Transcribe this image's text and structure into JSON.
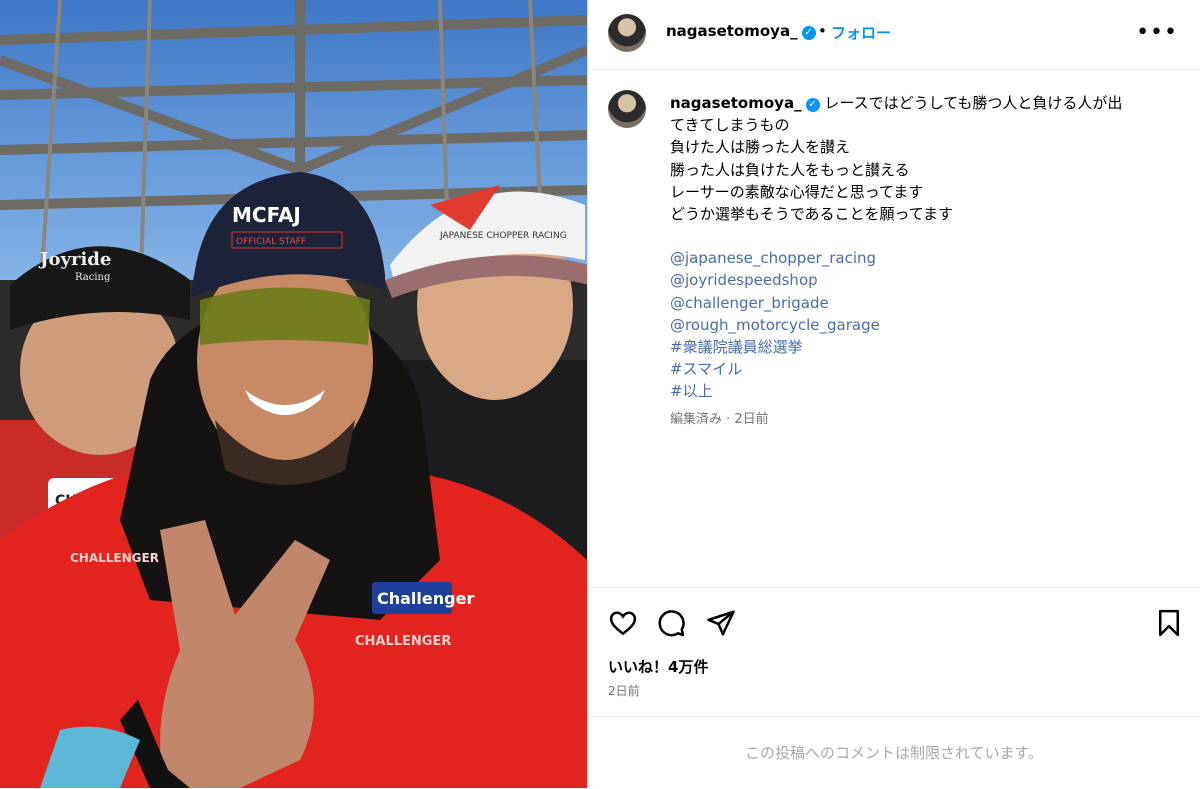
{
  "post": {
    "photo_alt": "Selfie of three men at a race track",
    "author": {
      "username": "nagasetomoya_",
      "verified_glyph": "✓",
      "separator": "•",
      "follow_label": "フォロー",
      "more_label": "•••"
    },
    "caption": {
      "username": "nagasetomoya_",
      "lines": [
        "レースではどうしても勝つ人と負ける人が出てきてしまうもの",
        "負けた人は勝った人を讃え",
        "勝った人は負けた人をもっと讃える",
        "レーサーの素敵な心得だと思ってます",
        "どうか選挙もそうであることを願ってます"
      ],
      "line_first": "レースではどうしても勝つ人と負ける人が出",
      "line_first_cont": "てきてしまうもの",
      "tags": [
        "@japanese_chopper_racing",
        "@joyridespeedshop",
        "@challenger_brigade",
        "@rough_motorcycle_garage",
        "#衆議院議員総選挙",
        "#スマイル",
        "#以上"
      ],
      "meta": "編集済み · 2日前"
    },
    "likes": "いいね！4万件",
    "date": "2日前",
    "comments_restricted": "この投稿へのコメントは制限されています。"
  },
  "icons": {
    "like": "heart-icon",
    "comment": "comment-icon",
    "share": "share-icon",
    "save": "bookmark-icon",
    "more": "more-icon"
  },
  "photo_text": {
    "cap_left": "Joyride",
    "cap_left_sub": "Racing",
    "cap_center": "MCFAJ",
    "cap_center_sub": "OFFICIAL STAFF",
    "cap_right": "JAPANESE CHOPPER RACING",
    "suit_logo": "Challenger",
    "suit_text": "CHALLENGER",
    "sleeve_text": "CHALLENGER",
    "jacket_badge": "CHALL"
  },
  "colors": {
    "accent": "#0095f6",
    "link": "#4a6bb0",
    "muted": "#737373"
  }
}
